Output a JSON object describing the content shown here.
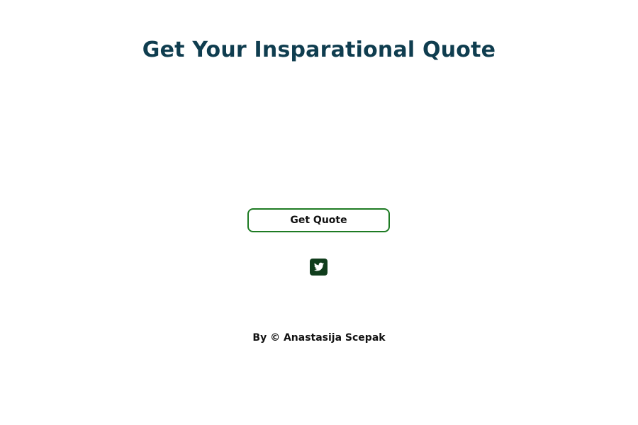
{
  "header": {
    "title": "Get Your Insparational Quote"
  },
  "quote": {
    "text": "",
    "author": ""
  },
  "actions": {
    "get_quote_label": "Get Quote",
    "share_icon": "twitter-icon"
  },
  "footer": {
    "credit": "By © Anastasija Scepak"
  },
  "colors": {
    "title": "#0f3d4f",
    "button_border": "#1e7b23",
    "twitter_icon_bg": "#103d1c",
    "text": "#111111",
    "background": "#ffffff"
  }
}
